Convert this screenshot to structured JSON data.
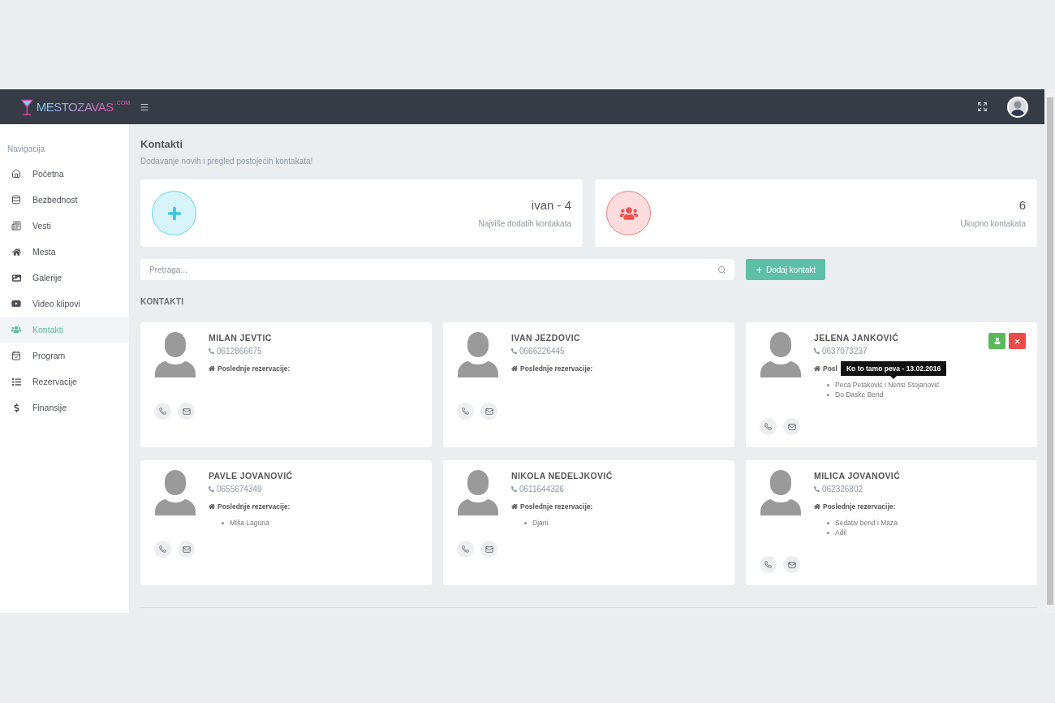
{
  "header": {
    "logo_text": "MESTOZAVAS",
    "logo_suffix": ".COM"
  },
  "sidebar": {
    "heading": "Navigacija",
    "items": [
      {
        "label": "Početna",
        "selected": false
      },
      {
        "label": "Bezbednost",
        "selected": false
      },
      {
        "label": "Vesti",
        "selected": false
      },
      {
        "label": "Mesta",
        "selected": false
      },
      {
        "label": "Galerije",
        "selected": false
      },
      {
        "label": "Video klipovi",
        "selected": false
      },
      {
        "label": "Kontakti",
        "selected": true
      },
      {
        "label": "Program",
        "selected": false
      },
      {
        "label": "Rezervacije",
        "selected": false
      },
      {
        "label": "Finansije",
        "selected": false
      }
    ]
  },
  "page": {
    "title": "Kontakti",
    "subtitle": "Dodavanje novih i pregled postojećih kontakata!"
  },
  "stats": [
    {
      "kind": "add",
      "value": "ivan - 4",
      "label": "Najviše dodatih kontakata"
    },
    {
      "kind": "total",
      "value": "6",
      "label": "Ukupno kontakata"
    }
  ],
  "search": {
    "placeholder": "Pretraga..."
  },
  "add_button": "Dodaj kontakt",
  "section_title": "KONTAKTI",
  "contacts": [
    {
      "name": "MILAN JEVTIC",
      "phone": "0612866675",
      "reservations_label": "Poslednje rezervacije:",
      "hovered": false
    },
    {
      "name": "IVAN JEZDOVIC",
      "phone": "0666226445",
      "reservations_label": "Poslednje rezervacije:",
      "hovered": false
    },
    {
      "name": "JELENA JANKOVIĆ",
      "phone": "0637073237",
      "reservations_label": "Posl",
      "tooltip": "Ko to tamo peva - 13.02.2016",
      "reservations": [
        "Peca Petaković i Nensi Stojanović",
        "Do Daske Bend"
      ],
      "hovered": true
    },
    {
      "name": "PAVLE JOVANOVIĆ",
      "phone": "0655674349",
      "reservations_label": "Poslednje rezervacije:",
      "reservations": [
        "Miša Laguna"
      ],
      "hovered": false
    },
    {
      "name": "NIKOLA NEDELJKOVIĆ",
      "phone": "0611644326",
      "reservations_label": "Poslednje rezervacije:",
      "reservations": [
        "Djani"
      ],
      "hovered": false
    },
    {
      "name": "MILICA JOVANOVIĆ",
      "phone": "062326802",
      "reservations_label": "Poslednje rezervacije:",
      "reservations": [
        "Sedativ bend i Maza",
        "Adil"
      ],
      "hovered": false
    }
  ]
}
